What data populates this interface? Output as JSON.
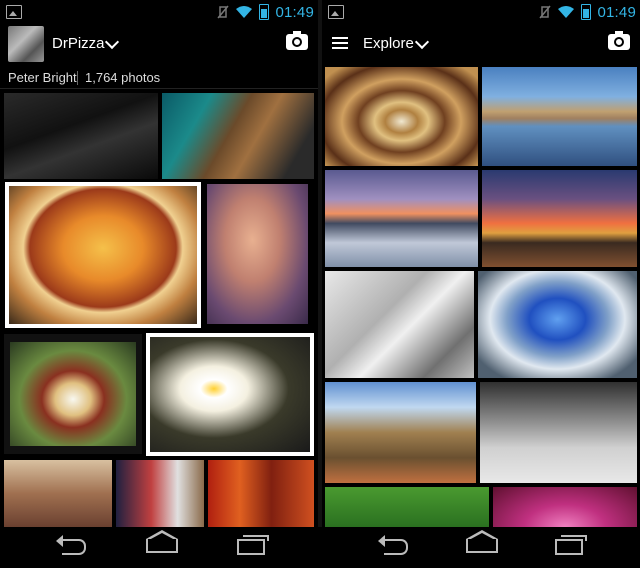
{
  "left_screen": {
    "status_bar": {
      "time": "01:49"
    },
    "action_bar": {
      "title": "DrPizza"
    },
    "profile": {
      "name": "Peter Bright",
      "photo_count": "1,764 photos"
    },
    "photos": [
      "keyboard-photo",
      "cat-photo",
      "plate-with-fork-knife-photo",
      "man-eating-photo",
      "breakfast-film-photo",
      "fried-eggs-pan-photo",
      "bacon-photo",
      "drinks-photo",
      "sausages-photo"
    ]
  },
  "right_screen": {
    "status_bar": {
      "time": "01:49"
    },
    "action_bar": {
      "title": "Explore"
    },
    "photos": [
      "spiral-staircase-photo",
      "mountain-lake-photo",
      "beach-sunset-photo",
      "signpost-sunset-photo",
      "seagull-photo",
      "tunnel-sky-photo",
      "road-trees-photo",
      "street-bicycle-photo",
      "bird-green-photo",
      "pink-flower-photo"
    ]
  },
  "colors": {
    "status_accent": "#33b5e5",
    "background": "#000000"
  }
}
